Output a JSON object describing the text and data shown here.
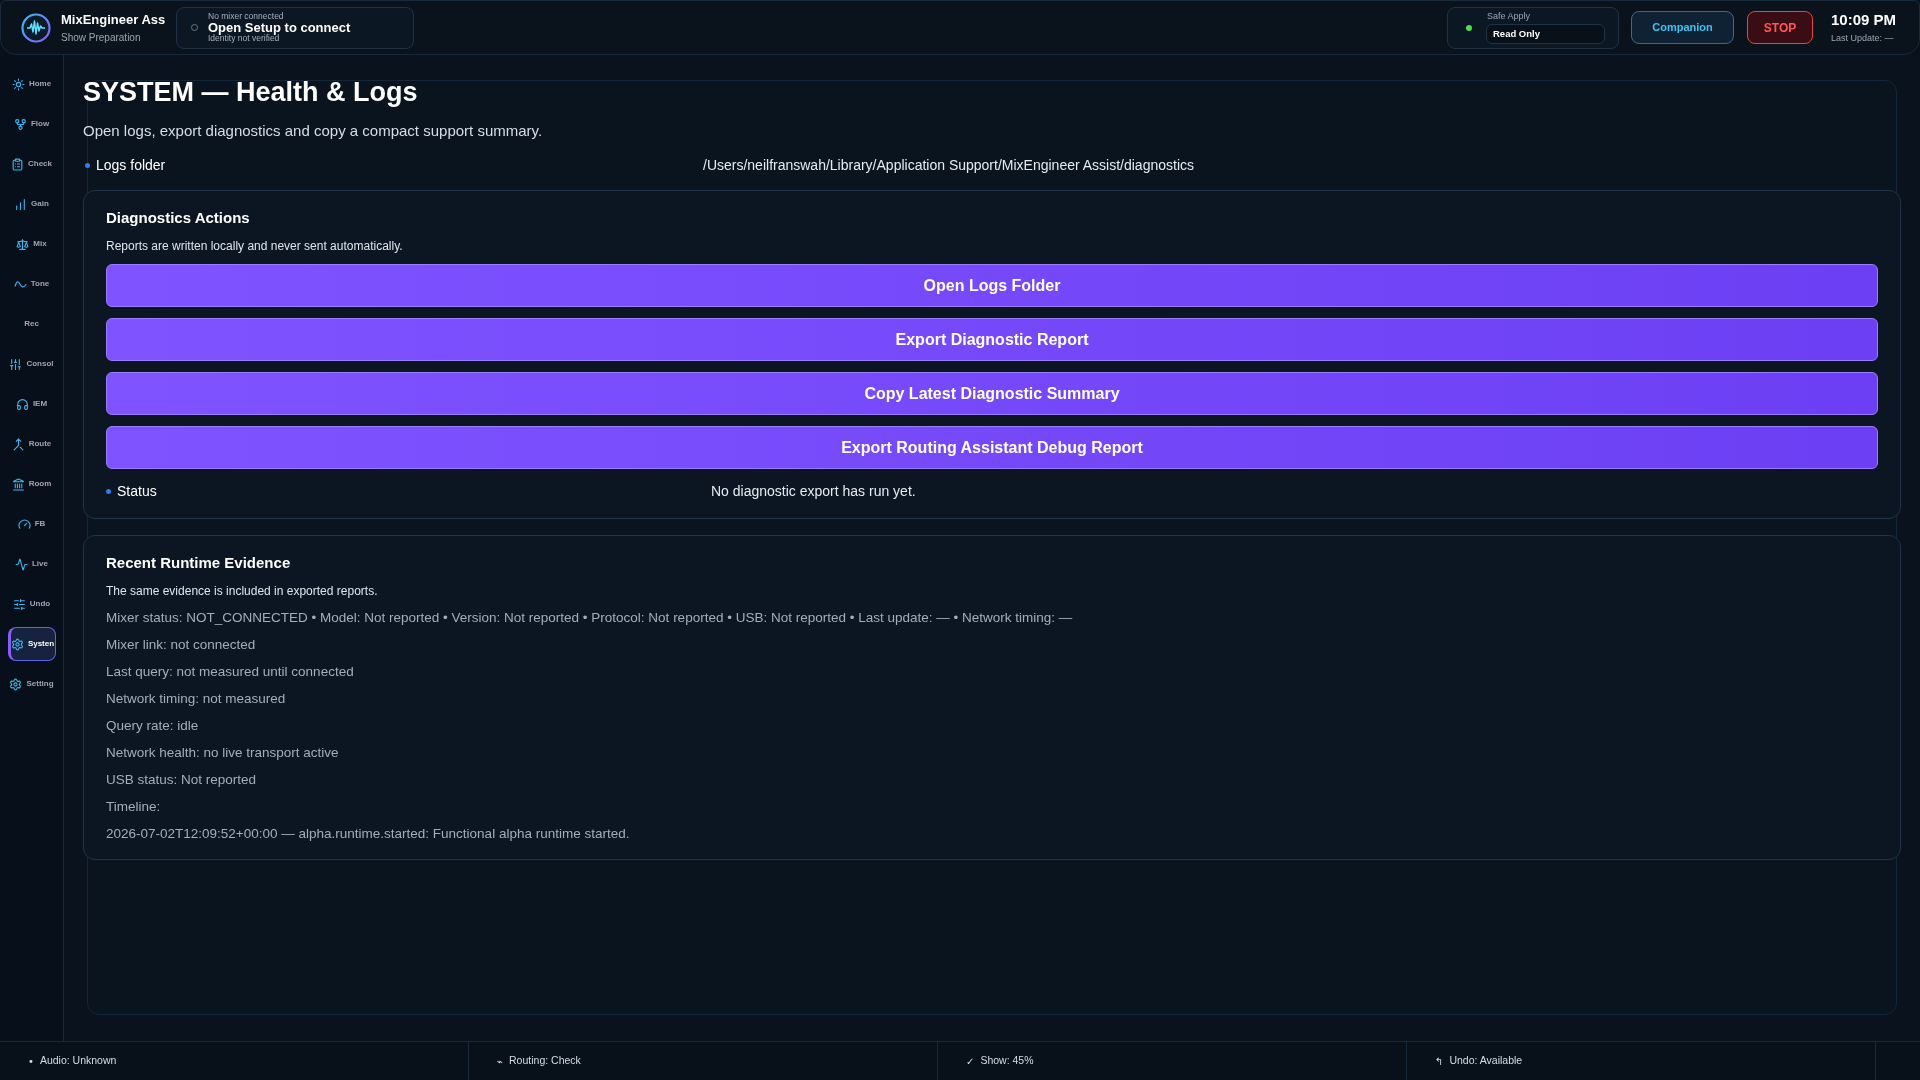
{
  "app": {
    "title": "MixEngineer Ass",
    "subtitle": "Show Preparation"
  },
  "connection": {
    "label": "No mixer connected",
    "title": "Open Setup to connect",
    "detail": "Identity not verified",
    "connected": false
  },
  "safe_apply": {
    "label": "Safe Apply",
    "value": "Read Only",
    "active": true
  },
  "header_buttons": [
    {
      "label": "Companion",
      "kind": "companion"
    },
    {
      "label": "STOP",
      "kind": "stop"
    }
  ],
  "clock": {
    "time": "10:09 PM",
    "last_update": "Last Update: —"
  },
  "sidebar": {
    "items": [
      {
        "label": "Home",
        "kind": "icon",
        "selected": false
      },
      {
        "label": "Flow",
        "kind": "icon",
        "selected": false
      },
      {
        "label": "Check",
        "kind": "icon",
        "selected": false
      },
      {
        "label": "Gain",
        "kind": "icon",
        "selected": false
      },
      {
        "label": "Mix",
        "kind": "icon",
        "selected": false
      },
      {
        "label": "Tone",
        "kind": "icon",
        "selected": false
      },
      {
        "label": "Rec",
        "kind": "label",
        "selected": false
      },
      {
        "label": "Consol",
        "kind": "icon",
        "selected": false
      },
      {
        "label": "IEM",
        "kind": "icon",
        "selected": false
      },
      {
        "label": "Route",
        "kind": "icon",
        "selected": false
      },
      {
        "label": "Room",
        "kind": "icon",
        "selected": false
      },
      {
        "label": "FB",
        "kind": "icon",
        "selected": false
      },
      {
        "label": "Live",
        "kind": "icon",
        "selected": false
      },
      {
        "label": "Undo",
        "kind": "icon",
        "selected": false
      },
      {
        "label": "Systen",
        "kind": "icon",
        "selected": true
      },
      {
        "label": "Setting",
        "kind": "icon",
        "selected": false
      }
    ]
  },
  "page": {
    "title": "SYSTEM — Health & Logs",
    "description": "Open logs, export diagnostics and copy a compact support summary.",
    "logs_folder": {
      "label": "Logs folder",
      "value": "/Users/neilfranswah/Library/Application Support/MixEngineer Assist/diagnostics"
    }
  },
  "diagnostics": {
    "title": "Diagnostics Actions",
    "note": "Reports are written locally and never sent automatically.",
    "actions": [
      "Open Logs Folder",
      "Export Diagnostic Report",
      "Copy Latest Diagnostic Summary",
      "Export Routing Assistant Debug Report"
    ],
    "status": {
      "label": "Status",
      "value": "No diagnostic export has run yet."
    }
  },
  "evidence": {
    "title": "Recent Runtime Evidence",
    "note": "The same evidence is included in exported reports.",
    "lines": [
      "Mixer status: NOT_CONNECTED • Model: Not reported • Version: Not reported • Protocol: Not reported • USB: Not reported • Last update: — • Network timing: —",
      "Mixer link: not connected",
      "Last query: not measured until connected",
      "Network timing: not measured",
      "Query rate: idle",
      "Network health: no live transport active",
      "USB status: Not reported",
      "Timeline:",
      "2026-07-02T12:09:52+00:00 — alpha.runtime.started: Functional alpha runtime started."
    ]
  },
  "status_bar": [
    {
      "icon": "•",
      "text": "Audio: Unknown"
    },
    {
      "icon": "⌁",
      "text": "Routing: Check"
    },
    {
      "icon": "✓",
      "text": "Show: 45%"
    },
    {
      "icon": "↰",
      "text": "Undo: Available"
    }
  ]
}
